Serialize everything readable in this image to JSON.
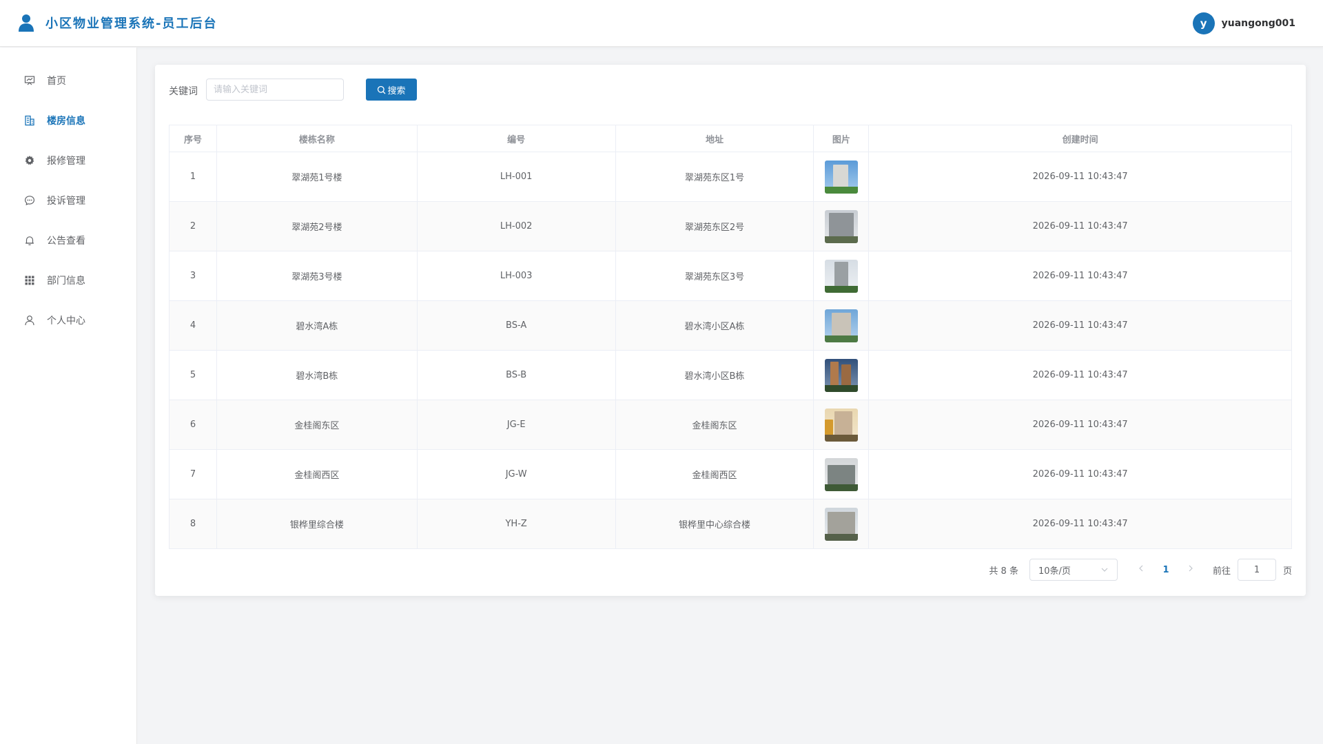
{
  "header": {
    "title": "小区物业管理系统-员工后台",
    "avatar_letter": "y",
    "username": "yuangong001",
    "accent_color": "#1a74b8"
  },
  "sidebar": {
    "items": [
      {
        "label": "首页",
        "icon": "dashboard-icon"
      },
      {
        "label": "楼房信息",
        "icon": "building-icon",
        "active": true
      },
      {
        "label": "报修管理",
        "icon": "gear-icon"
      },
      {
        "label": "投诉管理",
        "icon": "chat-bubble-icon"
      },
      {
        "label": "公告查看",
        "icon": "bell-icon"
      },
      {
        "label": "部门信息",
        "icon": "grid-icon"
      },
      {
        "label": "个人中心",
        "icon": "user-icon"
      }
    ]
  },
  "search": {
    "label": "关键词",
    "placeholder": "请输入关键词",
    "button_label": "搜索"
  },
  "table": {
    "columns": [
      "序号",
      "楼栋名称",
      "编号",
      "地址",
      "图片",
      "创建时间"
    ],
    "rows": [
      {
        "index": "1",
        "name": "翠湖苑1号楼",
        "code": "LH-001",
        "address": "翠湖苑东区1号",
        "created": "2026-09-11 10:43:47"
      },
      {
        "index": "2",
        "name": "翠湖苑2号楼",
        "code": "LH-002",
        "address": "翠湖苑东区2号",
        "created": "2026-09-11 10:43:47"
      },
      {
        "index": "3",
        "name": "翠湖苑3号楼",
        "code": "LH-003",
        "address": "翠湖苑东区3号",
        "created": "2026-09-11 10:43:47"
      },
      {
        "index": "4",
        "name": "碧水湾A栋",
        "code": "BS-A",
        "address": "碧水湾小区A栋",
        "created": "2026-09-11 10:43:47"
      },
      {
        "index": "5",
        "name": "碧水湾B栋",
        "code": "BS-B",
        "address": "碧水湾小区B栋",
        "created": "2026-09-11 10:43:47"
      },
      {
        "index": "6",
        "name": "金桂阁东区",
        "code": "JG-E",
        "address": "金桂阁东区",
        "created": "2026-09-11 10:43:47"
      },
      {
        "index": "7",
        "name": "金桂阁西区",
        "code": "JG-W",
        "address": "金桂阁西区",
        "created": "2026-09-11 10:43:47"
      },
      {
        "index": "8",
        "name": "银桦里综合楼",
        "code": "YH-Z",
        "address": "银桦里中心综合楼",
        "created": "2026-09-11 10:43:47"
      }
    ]
  },
  "pagination": {
    "total_text": "共 8 条",
    "page_size": "10条/页",
    "current_page": "1",
    "goto_label": "前往",
    "goto_value": "1",
    "goto_unit": "页"
  }
}
